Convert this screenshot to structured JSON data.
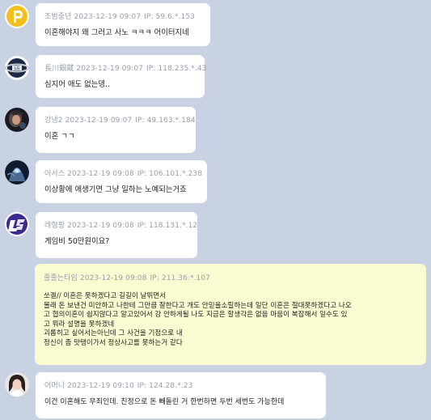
{
  "messages": [
    {
      "nick": "초범중년",
      "date": "2023-12-19 09:07",
      "ip": "IP: 59.6.*.153",
      "lines": [
        "이혼해야지 왜 그러고 사노 ㅋㅋㅋ 어이터지네"
      ],
      "avatar": "yellow-p-logo-icon",
      "highlight": false
    },
    {
      "nick": "長川銀蔵",
      "date": "2023-12-19 09:07",
      "ip": "IP: 118.235.*.43",
      "lines": [
        "심지어 애도 없는뎅.."
      ],
      "avatar": "team-emblem-icon",
      "highlight": false
    },
    {
      "nick": "강냉2",
      "date": "2023-12-19 09:07",
      "ip": "IP: 49.163.*.184",
      "lines": [
        "이혼 ㄱㄱ"
      ],
      "avatar": "character-portrait-icon",
      "highlight": false
    },
    {
      "nick": "아서스",
      "date": "2023-12-19 09:08",
      "ip": "IP: 106.101.*.238",
      "lines": [
        "이상황에 애생기면 그냥 일하는 노예되는거죠"
      ],
      "avatar": "armored-knight-icon",
      "highlight": false
    },
    {
      "nick": "레형팡",
      "date": "2023-12-19 09:08",
      "ip": "IP: 118.131.*.12",
      "lines": [
        "게임비 50만원이요?"
      ],
      "avatar": "purple-emblem-icon",
      "highlight": false
    },
    {
      "nick": "줄줄는타임",
      "date": "2023-12-19 09:08",
      "ip": "IP: 211.36.*.107",
      "lines": [
        "쏘겔// 이혼은 못하겠다고 길길이 날뛰면서",
        "몰래 돈 보낸건 미안하고 나한테 그만큼 잘한다고 개도 안믿을소릴하는데 일단 이혼은 절대못하겠다고 나오",
        "고 협의이혼이 쉽지않다고 알고있어서 강 안하게될 나도 지금은 할생각은 없음 마음이 복잡해서 일수도 있",
        "고 뭐라 설명을 못하겠네",
        "괴롭히고 싶어서는아닌데 그 사건을 기점으로 내",
        "정신이 좀 맛탱이가서 정상사고를 못하는거 같다"
      ],
      "avatar": "",
      "highlight": true
    },
    {
      "nick": "어머니",
      "date": "2023-12-19 09:10",
      "ip": "IP: 124.28.*.23",
      "lines": [
        "이건 이혼해도 무죄인데. 친정으로 돈 빼돌린 거 한번하면 두번 세번도 가능한데"
      ],
      "avatar": "woman-photo-icon",
      "highlight": false
    }
  ],
  "colors": {
    "background": "#c9d2e3",
    "bubble": "#ffffff",
    "highlight_bubble": "#fbfbd2",
    "meta_text": "#98a0ab",
    "body_text": "#1e1e1e"
  }
}
